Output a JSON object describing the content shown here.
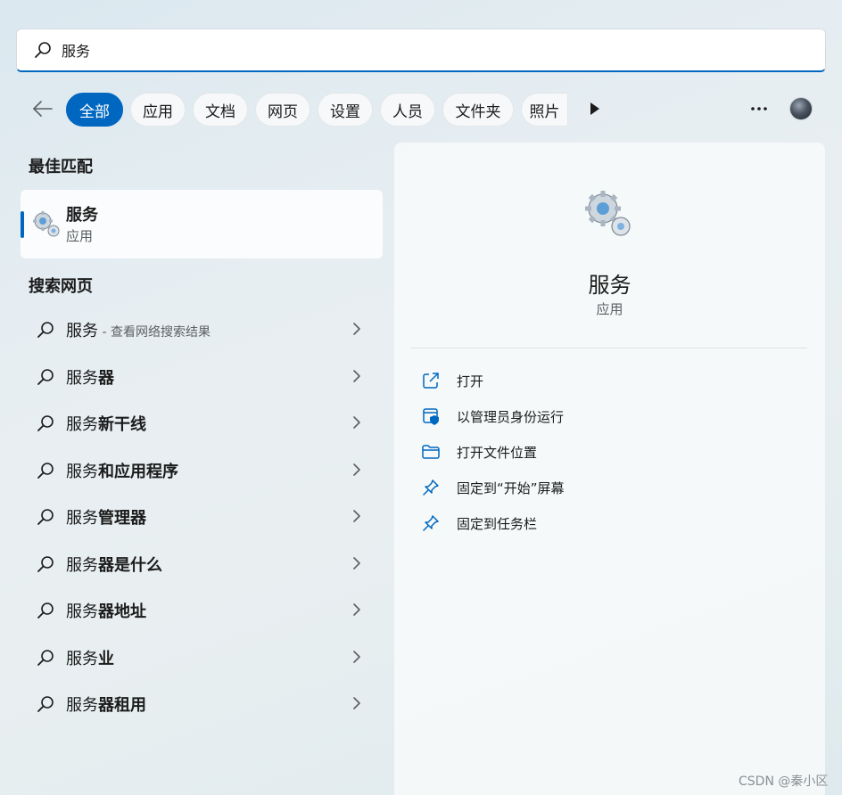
{
  "search": {
    "value": "服务"
  },
  "filters": {
    "chips": [
      "全部",
      "应用",
      "文档",
      "网页",
      "设置",
      "人员",
      "文件夹",
      "照片"
    ]
  },
  "left": {
    "best_match_title": "最佳匹配",
    "best_match": {
      "title": "服务",
      "subtitle": "应用"
    },
    "web_title": "搜索网页",
    "web_results": [
      {
        "query": "服务",
        "bold": "",
        "desc": " - 查看网络搜索结果"
      },
      {
        "query": "服务",
        "bold": "器",
        "desc": ""
      },
      {
        "query": "服务",
        "bold": "新干线",
        "desc": ""
      },
      {
        "query": "服务",
        "bold": "和应用程序",
        "desc": ""
      },
      {
        "query": "服务",
        "bold": "管理器",
        "desc": ""
      },
      {
        "query": "服务",
        "bold": "器是什么",
        "desc": ""
      },
      {
        "query": "服务",
        "bold": "器地址",
        "desc": ""
      },
      {
        "query": "服务",
        "bold": "业",
        "desc": ""
      },
      {
        "query": "服务",
        "bold": "器租用",
        "desc": ""
      }
    ]
  },
  "detail": {
    "title": "服务",
    "subtitle": "应用",
    "actions": [
      "打开",
      "以管理员身份运行",
      "打开文件位置",
      "固定到“开始”屏幕",
      "固定到任务栏"
    ]
  },
  "watermark": "CSDN @秦小区",
  "colors": {
    "accent": "#0067c0",
    "text": "#1b1b1b",
    "muted": "#5b5f63"
  },
  "icons": {
    "search": "search-icon",
    "back": "back-arrow-icon",
    "play": "play-icon",
    "more": "more-icon",
    "app": "gears-icon",
    "chevron": "chevron-right-icon",
    "actions": [
      "open-external-icon",
      "shield-admin-icon",
      "folder-icon",
      "pin-icon",
      "pin-icon"
    ]
  }
}
